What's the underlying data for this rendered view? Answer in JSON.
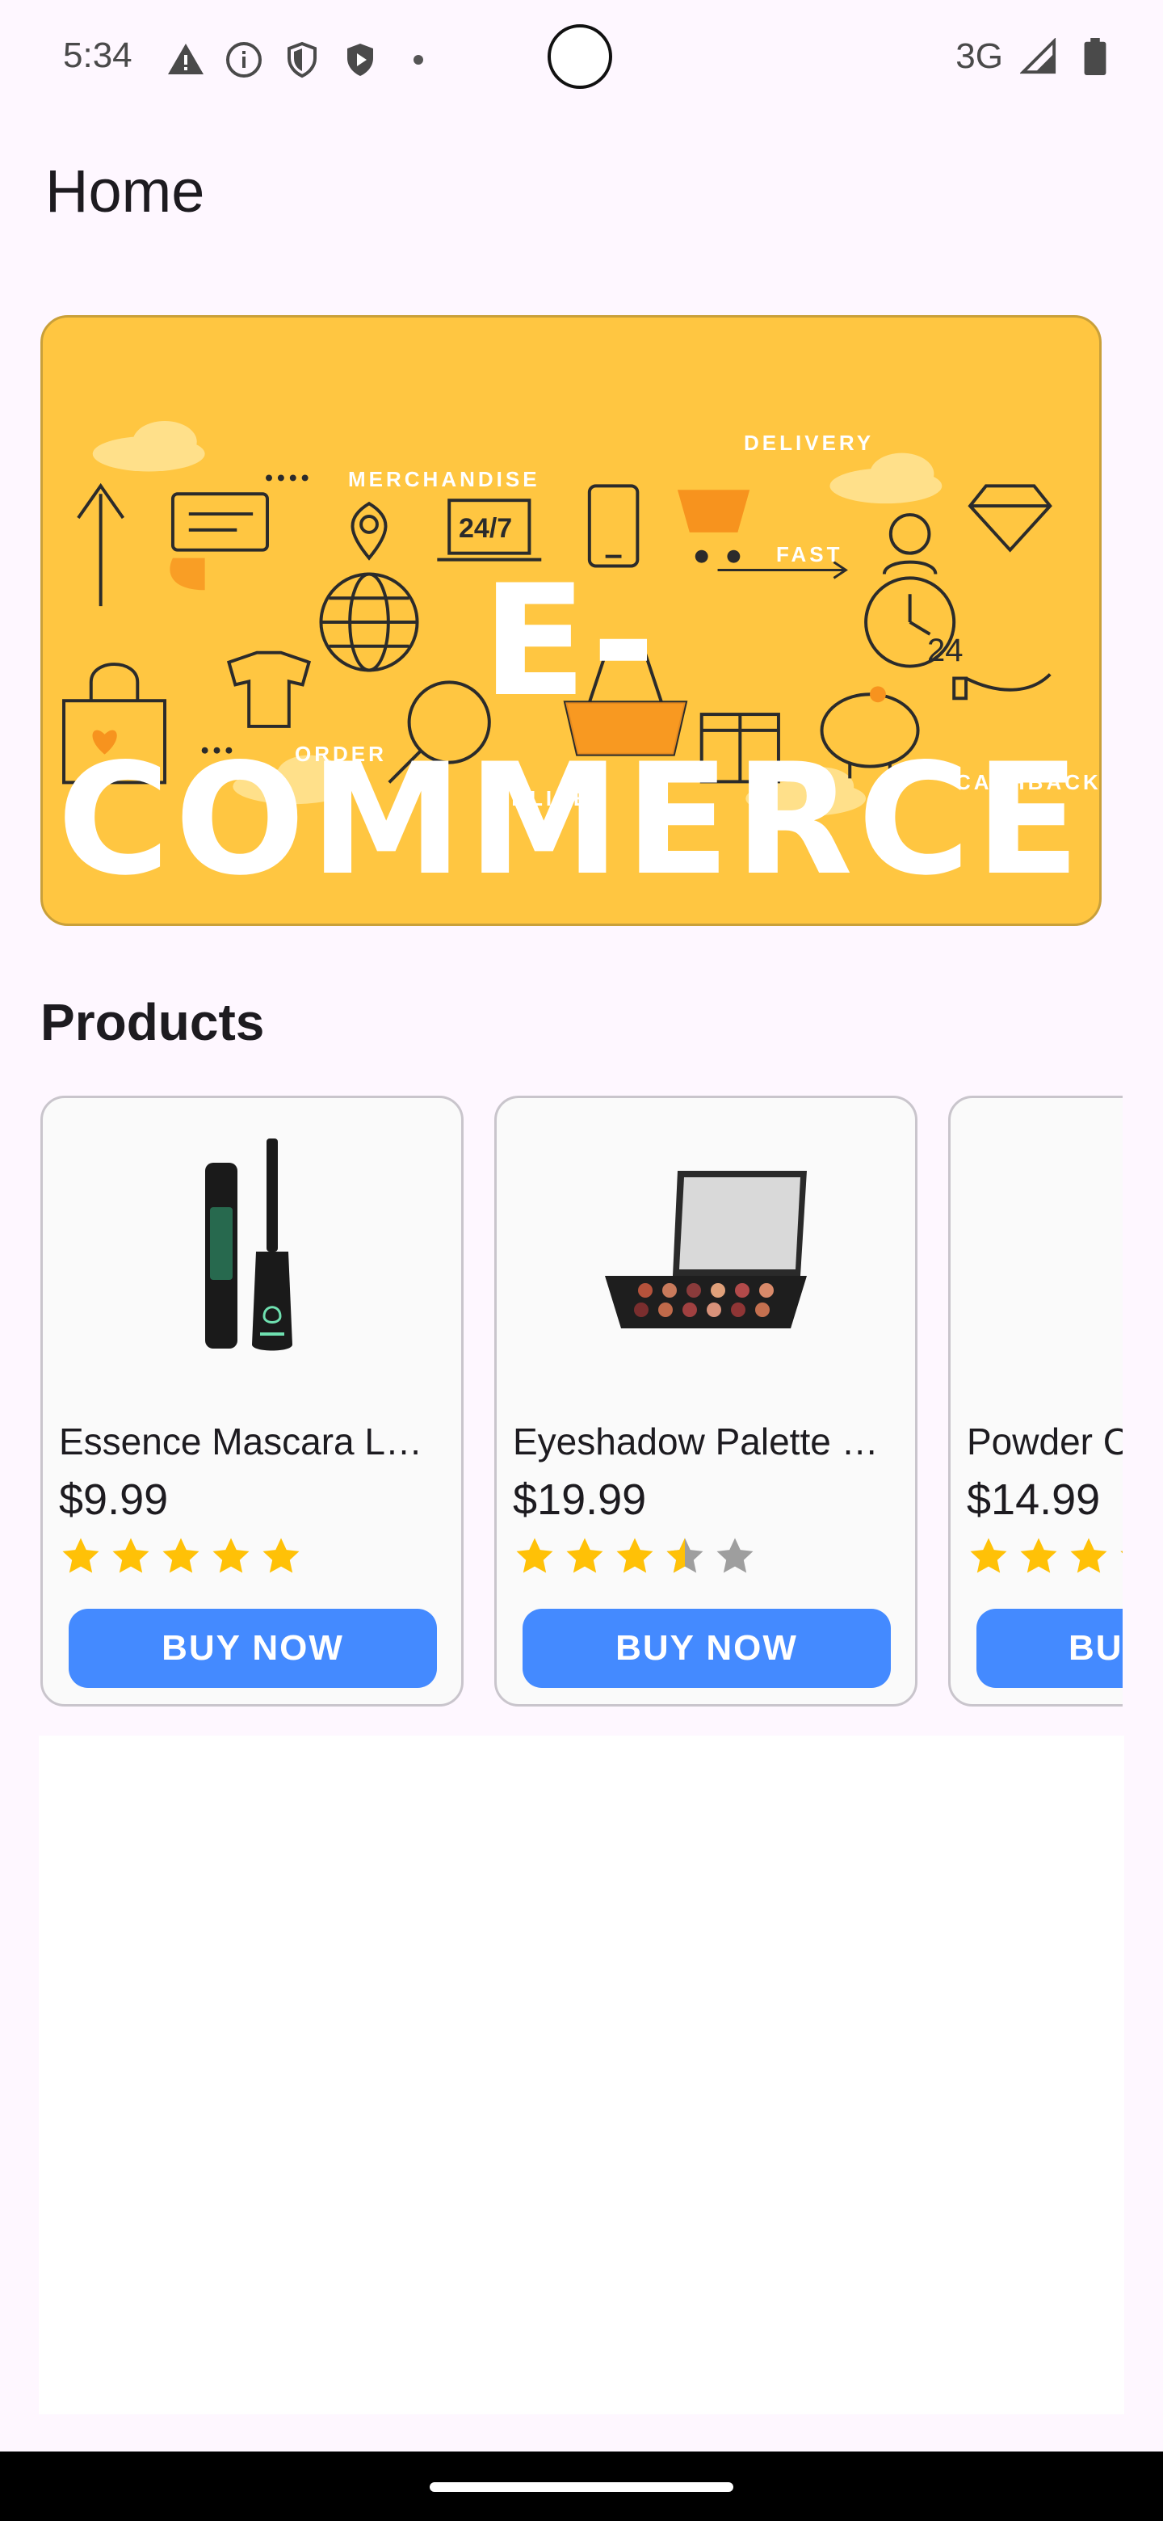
{
  "status_bar": {
    "time": "5:34",
    "left_icons": [
      "warning-icon",
      "info-icon",
      "shield-icon",
      "play-shield-icon"
    ],
    "network": "3G",
    "right_icons": [
      "signal-icon",
      "battery-icon"
    ]
  },
  "app_bar": {
    "title": "Home"
  },
  "banner": {
    "title": "E-COMMERCE",
    "labels": {
      "merchandise": "MERCHANDISE",
      "delivery": "DELIVERY",
      "fast": "FAST",
      "order": "ORDER",
      "online": "ONLINE",
      "cashback": "CASHBACK",
      "hours": "24/7",
      "day": "24"
    },
    "background_color": "#FFC641",
    "accent_color": "#F7931E"
  },
  "products_section": {
    "title": "Products",
    "items": [
      {
        "name": "Essence Mascara L…",
        "price": "$9.99",
        "rating": 5,
        "button_label": "BUY NOW",
        "image_icon": "mascara-icon"
      },
      {
        "name": "Eyeshadow Palette …",
        "price": "$19.99",
        "rating": 3.5,
        "button_label": "BUY NOW",
        "image_icon": "eyeshadow-palette-icon"
      },
      {
        "name": "Powder C",
        "price": "$14.99",
        "rating": 3.5,
        "button_label": "BU",
        "image_icon": "powder-compact-icon"
      }
    ]
  },
  "colors": {
    "page_background": "#FEF7FF",
    "button_blue": "#448AFF",
    "star_filled": "#FFC107",
    "star_empty": "#9E9E9E"
  }
}
